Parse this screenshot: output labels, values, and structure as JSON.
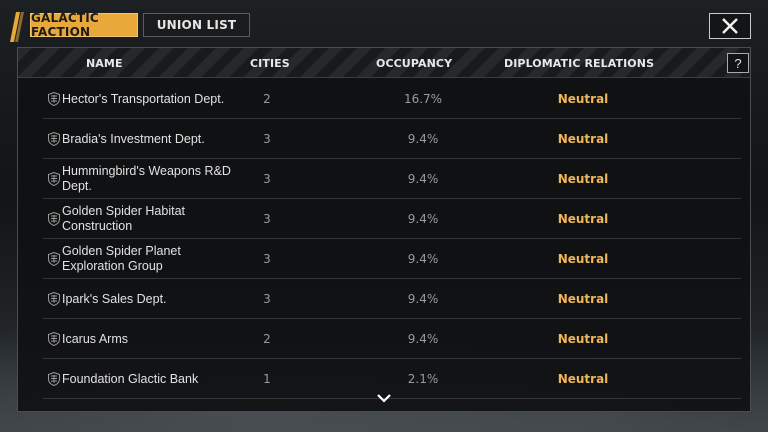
{
  "tabs": [
    {
      "label": "GALACTIC FACTION",
      "active": true
    },
    {
      "label": "UNION LIST",
      "active": false
    }
  ],
  "table": {
    "headers": {
      "name": "NAME",
      "cities": "CITIES",
      "occupancy": "OCCUPANCY",
      "relations": "DIPLOMATIC RELATIONS"
    },
    "help_label": "?",
    "rows": [
      {
        "name": "Hector's Transportation Dept.",
        "cities": "2",
        "occupancy": "16.7%",
        "relation": "Neutral"
      },
      {
        "name": "Bradia's Investment Dept.",
        "cities": "3",
        "occupancy": "9.4%",
        "relation": "Neutral"
      },
      {
        "name": "Hummingbird's Weapons R&D Dept.",
        "cities": "3",
        "occupancy": "9.4%",
        "relation": "Neutral"
      },
      {
        "name": "Golden Spider Habitat Construction",
        "cities": "3",
        "occupancy": "9.4%",
        "relation": "Neutral"
      },
      {
        "name": "Golden Spider Planet Exploration Group",
        "cities": "3",
        "occupancy": "9.4%",
        "relation": "Neutral"
      },
      {
        "name": "Ipark's Sales Dept.",
        "cities": "3",
        "occupancy": "9.4%",
        "relation": "Neutral"
      },
      {
        "name": "Icarus Arms",
        "cities": "2",
        "occupancy": "9.4%",
        "relation": "Neutral"
      },
      {
        "name": "Foundation Glactic Bank",
        "cities": "1",
        "occupancy": "2.1%",
        "relation": "Neutral"
      }
    ]
  },
  "icons": {
    "close": "close-icon",
    "faction": "faction-emblem-icon",
    "scroll": "chevron-down-icon"
  },
  "colors": {
    "accent": "#e9a83a",
    "relation_neutral": "#f0b65a"
  }
}
